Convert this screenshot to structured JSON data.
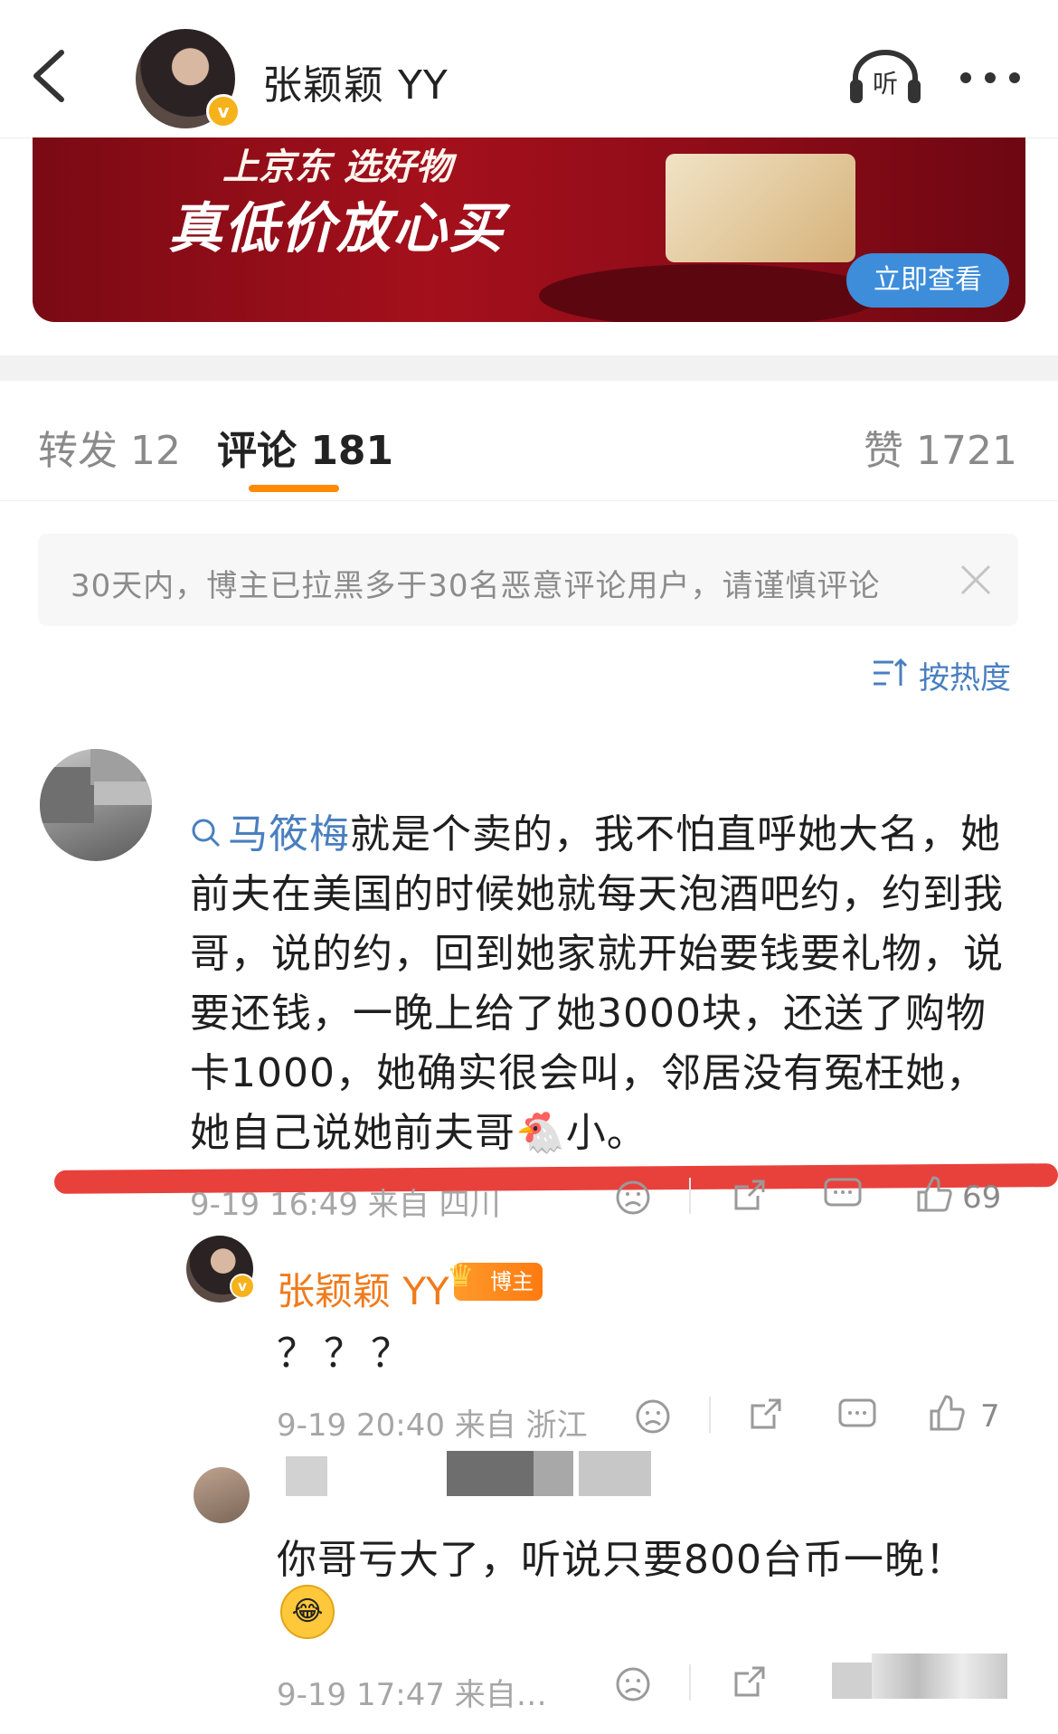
{
  "header": {
    "title": "张颖颖 YY",
    "verified_mark": "v"
  },
  "banner": {
    "line1": "上京东 选好物",
    "line2": "真低价放心买",
    "button": "立即查看"
  },
  "tabs": {
    "repost": "转发 12",
    "comment": "评论 181",
    "like": "赞 1721"
  },
  "notice": {
    "text": "30天内，博主已拉黑多于30名恶意评论用户，请谨慎评论"
  },
  "sort": {
    "label": "按热度"
  },
  "comment": {
    "topic": "马筱梅",
    "text_part1": "就是个卖的，我不怕直呼她大名，她前夫在美国的时候她就每天泡酒吧约，约到我哥，说的约，回到她家就开始要钱要礼物，说要还钱，一晚上给了她3000块，还送了购物卡1000，她确实很会叫，邻居没有冤枉她，她自己说她前夫哥",
    "emoji": "🐔",
    "text_part2": "小。",
    "meta": "9-19 16:49 来自 四川",
    "likes": "69"
  },
  "reply1": {
    "name": "张颖颖 YY",
    "badge": "博主",
    "text": "？？？",
    "meta": "9-19 20:40 来自 浙江",
    "likes": "7"
  },
  "reply2": {
    "text": "你哥亏大了，听说只要800台币一晚！",
    "emoji": "😂",
    "meta": "9-19 17:47 来自…"
  },
  "colors": {
    "accent_orange": "#ff8a00",
    "link_blue": "#4a7fbf",
    "owner_name": "#f07b1c",
    "highlight_red": "#e8413c"
  }
}
